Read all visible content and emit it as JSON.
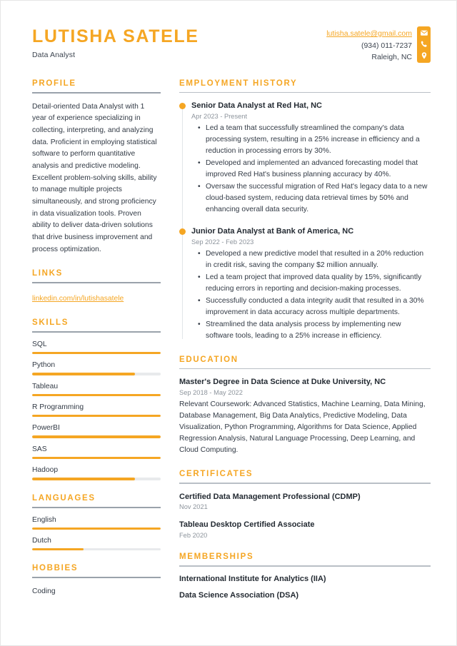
{
  "header": {
    "name": "LUTISHA SATELE",
    "job_title": "Data Analyst",
    "contact": {
      "email": "lutisha.satele@gmail.com",
      "phone": "(934) 011-7237",
      "location": "Raleigh, NC"
    },
    "icons": [
      "envelope-icon",
      "phone-icon",
      "location-pin-icon"
    ],
    "accent_color": "#F5A623",
    "text_color": "#323a45"
  },
  "sidebar": {
    "profile": {
      "heading": "PROFILE",
      "text": "Detail-oriented Data Analyst with 1 year of experience specializing in collecting, interpreting, and analyzing data. Proficient in employing statistical software to perform quantitative analysis and predictive modeling. Excellent problem-solving skills, ability to manage multiple projects simultaneously, and strong proficiency in data visualization tools. Proven ability to deliver data-driven solutions that drive business improvement and process optimization."
    },
    "links": {
      "heading": "LINKS",
      "items": [
        {
          "label": "linkedin.com/in/lutishasatele"
        }
      ]
    },
    "skills": {
      "heading": "SKILLS",
      "items": [
        {
          "label": "SQL",
          "level": 100
        },
        {
          "label": "Python",
          "level": 80
        },
        {
          "label": "Tableau",
          "level": 100
        },
        {
          "label": "R Programming",
          "level": 100
        },
        {
          "label": "PowerBI",
          "level": 100
        },
        {
          "label": "SAS",
          "level": 100
        },
        {
          "label": "Hadoop",
          "level": 80
        }
      ]
    },
    "languages": {
      "heading": "LANGUAGES",
      "items": [
        {
          "label": "English",
          "level": 100
        },
        {
          "label": "Dutch",
          "level": 40
        }
      ]
    },
    "hobbies": {
      "heading": "HOBBIES",
      "items": [
        {
          "label": "Coding"
        }
      ]
    }
  },
  "main": {
    "employment": {
      "heading": "EMPLOYMENT HISTORY",
      "jobs": [
        {
          "title": "Senior Data Analyst at Red Hat, NC",
          "date": "Apr 2023 - Present",
          "bullets": [
            "Led a team that successfully streamlined the company's data processing system, resulting in a 25% increase in efficiency and a reduction in processing errors by 30%.",
            "Developed and implemented an advanced forecasting model that improved Red Hat's business planning accuracy by 40%.",
            "Oversaw the successful migration of Red Hat's legacy data to a new cloud-based system, reducing data retrieval times by 50% and enhancing overall data security."
          ]
        },
        {
          "title": "Junior Data Analyst at Bank of America, NC",
          "date": "Sep 2022 - Feb 2023",
          "bullets": [
            "Developed a new predictive model that resulted in a 20% reduction in credit risk, saving the company $2 million annually.",
            "Led a team project that improved data quality by 15%, significantly reducing errors in reporting and decision-making processes.",
            "Successfully conducted a data integrity audit that resulted in a 30% improvement in data accuracy across multiple departments.",
            "Streamlined the data analysis process by implementing new software tools, leading to a 25% increase in efficiency."
          ]
        }
      ]
    },
    "education": {
      "heading": "EDUCATION",
      "entries": [
        {
          "title": "Master's Degree in Data Science at Duke University, NC",
          "date": "Sep 2018 - May 2022",
          "description": "Relevant Coursework: Advanced Statistics, Machine Learning, Data Mining, Database Management, Big Data Analytics, Predictive Modeling, Data Visualization, Python Programming, Algorithms for Data Science, Applied Regression Analysis, Natural Language Processing, Deep Learning, and Cloud Computing."
        }
      ]
    },
    "certificates": {
      "heading": "CERTIFICATES",
      "entries": [
        {
          "title": "Certified Data Management Professional (CDMP)",
          "date": "Nov 2021"
        },
        {
          "title": "Tableau Desktop Certified Associate",
          "date": "Feb 2020"
        }
      ]
    },
    "memberships": {
      "heading": "MEMBERSHIPS",
      "entries": [
        {
          "title": "International Institute for Analytics (IIA)"
        },
        {
          "title": "Data Science Association (DSA)"
        }
      ]
    }
  }
}
